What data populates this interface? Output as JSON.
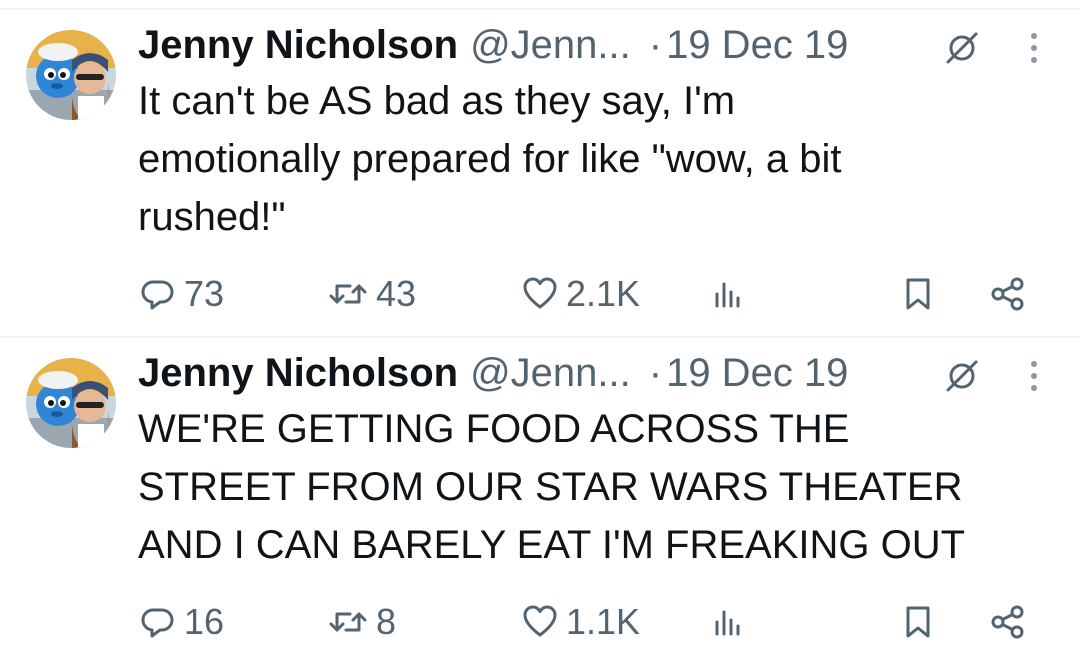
{
  "tweets": [
    {
      "name": "Jenny Nicholson",
      "handle": "@Jenn...",
      "separator": "·",
      "date": "19 Dec 19",
      "text": "It can't be AS bad as they say, I'm\nemotionally prepared for like \"wow, a bit\nrushed!\"",
      "replies": "73",
      "retweets": "43",
      "likes": "2.1K"
    },
    {
      "name": "Jenny Nicholson",
      "handle": "@Jenn...",
      "separator": "·",
      "date": "19 Dec 19",
      "text": "WE'RE GETTING FOOD ACROSS THE\nSTREET FROM OUR STAR WARS THEATER\nAND I CAN BARELY EAT I'M FREAKING OUT",
      "replies": "16",
      "retweets": "8",
      "likes": "1.1K"
    }
  ],
  "icons": {
    "avatar": "avatar-image",
    "grok": "grok-icon",
    "more": "more-icon",
    "reply": "reply-icon",
    "retweet": "retweet-icon",
    "like": "heart-icon",
    "views": "views-icon",
    "bookmark": "bookmark-icon",
    "share": "share-icon"
  },
  "colors": {
    "text": "#0f1419",
    "secondary": "#536471",
    "divider": "#eff3f4",
    "background": "#ffffff"
  }
}
